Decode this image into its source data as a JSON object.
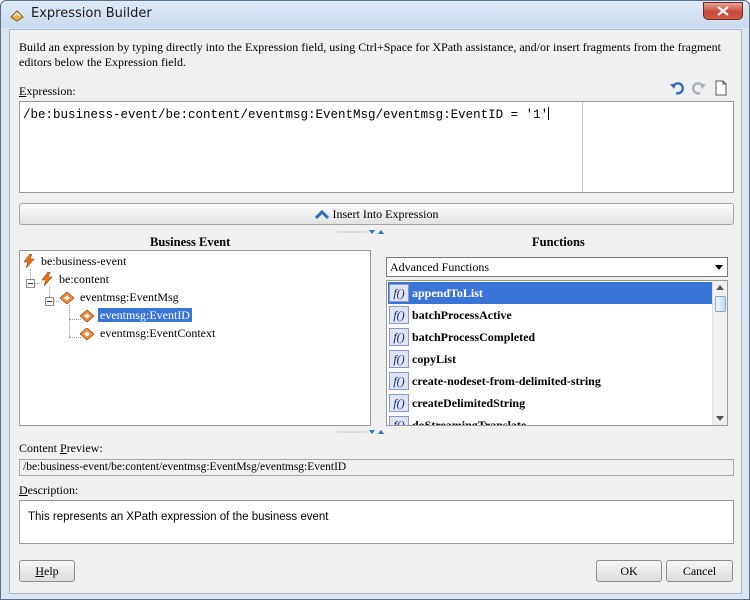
{
  "window": {
    "title": "Expression Builder",
    "icon": "expression-builder-app-icon"
  },
  "instructions": "Build an expression by typing directly into the Expression field, using Ctrl+Space for XPath assistance, and/or insert fragments from the fragment editors below the Expression field.",
  "expression": {
    "label_mnemonic": "E",
    "label_rest": "xpression:",
    "value": "/be:business-event/be:content/eventmsg:EventMsg/eventmsg:EventID = '1'",
    "tools": [
      "undo-icon",
      "redo-icon",
      "clear-document-icon"
    ]
  },
  "insert_button": {
    "label": "Insert Into Expression",
    "icon": "chevron-up-icon"
  },
  "business_event": {
    "title": "Business Event",
    "tree": [
      {
        "label": "be:business-event",
        "icon": "lightning-icon",
        "level": 0,
        "selected": false
      },
      {
        "label": "be:content",
        "icon": "lightning-icon",
        "level": 1,
        "selected": false
      },
      {
        "label": "eventmsg:EventMsg",
        "icon": "element-icon",
        "level": 2,
        "selected": false
      },
      {
        "label": "eventmsg:EventID",
        "icon": "element-icon",
        "level": 3,
        "selected": true
      },
      {
        "label": "eventmsg:EventContext",
        "icon": "element-icon",
        "level": 3,
        "selected": false
      }
    ]
  },
  "functions": {
    "title": "Functions",
    "category": "Advanced Functions",
    "items": [
      {
        "name": "appendToList",
        "selected": true
      },
      {
        "name": "batchProcessActive",
        "selected": false
      },
      {
        "name": "batchProcessCompleted",
        "selected": false
      },
      {
        "name": "copyList",
        "selected": false
      },
      {
        "name": "create-nodeset-from-delimited-string",
        "selected": false
      },
      {
        "name": "createDelimitedString",
        "selected": false
      },
      {
        "name": "doStreamingTranslate",
        "selected": false
      }
    ],
    "fx_glyph": "f()"
  },
  "content_preview": {
    "label_before": "Content ",
    "label_mnemonic": "P",
    "label_after": "review:",
    "value": "/be:business-event/be:content/eventmsg:EventMsg/eventmsg:EventID"
  },
  "description": {
    "label_mnemonic": "D",
    "label_rest": "escription:",
    "value": "This represents an XPath expression of the business event"
  },
  "buttons": {
    "help_mnemonic": "H",
    "help_rest": "elp",
    "ok": "OK",
    "cancel": "Cancel"
  },
  "colors": {
    "selection": "#3875d7",
    "window_border": "#5b6f86",
    "close_button": "#c7463a"
  }
}
